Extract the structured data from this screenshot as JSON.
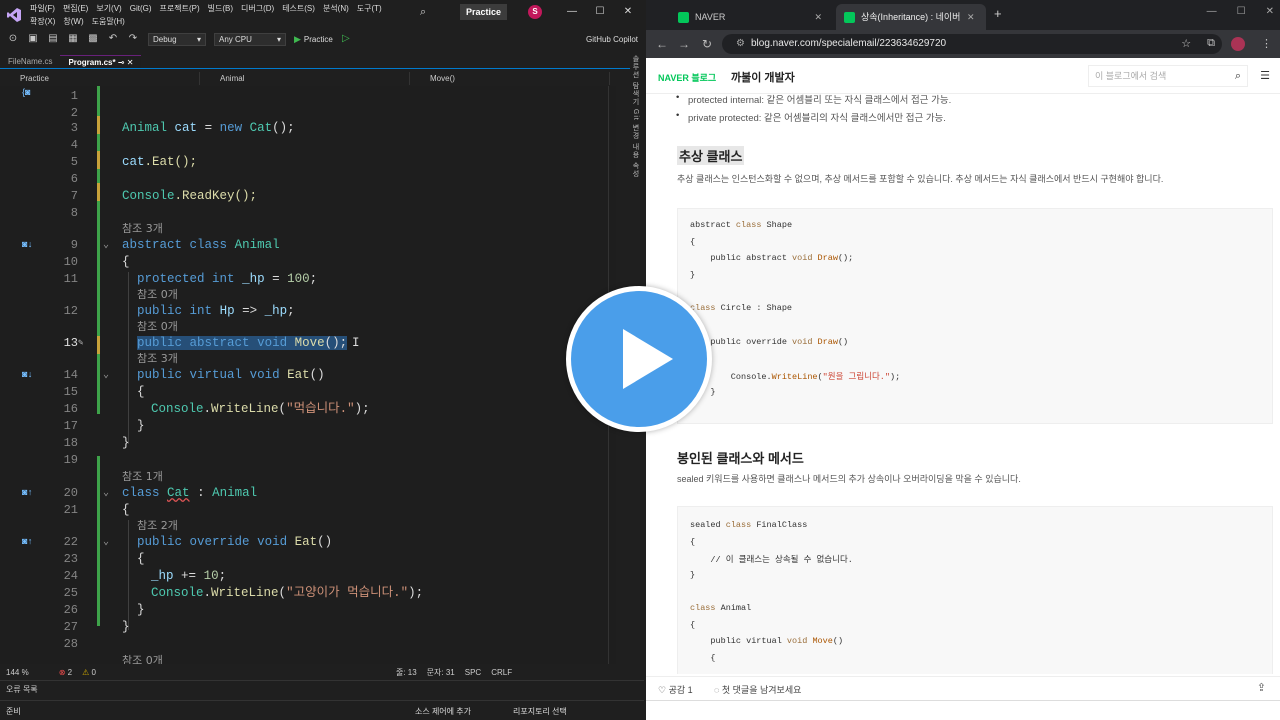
{
  "vs": {
    "menus": [
      "파일(F)",
      "편집(E)",
      "보기(V)",
      "Git(G)",
      "프로젝트(P)",
      "빌드(B)",
      "디버그(D)",
      "테스트(S)",
      "분석(N)",
      "도구(T)",
      "확장(X)",
      "창(W)",
      "도움말(H)"
    ],
    "title": "Practice",
    "avatar": "S",
    "toolbar": {
      "config": "Debug",
      "platform": "Any CPU",
      "run_label": "Practice",
      "copilot": "GitHub Copilot"
    },
    "tabs": [
      "FileName.cs",
      "Program.cs*"
    ],
    "navbar": {
      "project": "Practice",
      "class": "Animal",
      "member": "Move()"
    },
    "side_panel": "솔루션 탐색기 Git 변경 내용 속성",
    "code": {
      "l3": {
        "type": "Animal",
        "var": "cat",
        "eq": "=",
        "new": "new",
        "ctor": "Cat",
        "end": "();"
      },
      "l5": {
        "obj": "cat",
        "call": ".Eat();"
      },
      "l7": {
        "cls": "Console",
        "call": ".ReadKey();"
      },
      "refs_3": "참조 3개",
      "refs_0": "참조 0개",
      "refs_1": "참조 1개",
      "refs_2": "참조 2개",
      "kw_abstract": "abstract",
      "kw_class": "class",
      "kw_protected": "protected",
      "kw_int": "int",
      "kw_public": "public",
      "kw_void": "void",
      "kw_virtual": "virtual",
      "kw_override": "override",
      "name_animal": "Animal",
      "name_cat": "Cat",
      "field_hp": "_hp",
      "num_100": "100",
      "num_10": "10",
      "prop_hp": "Hp",
      "arrow": "=>",
      "move": "Move",
      "eat": "Eat",
      "console": "Console",
      "writeline": "WriteLine",
      "str_eat": "\"먹습니다.\"",
      "str_cat_eat": "\"고양이가 먹습니다.\"",
      "colon": ":",
      "plus_eq": "+="
    },
    "status": {
      "zoom": "144 %",
      "errors": "2",
      "warnings": "0",
      "line": "줄: 13",
      "col": "문자: 31",
      "spc": "SPC",
      "crlf": "CRLF"
    },
    "error_list": "오류 목록",
    "ready": "준비",
    "scm": "소스 제어에 추가",
    "repo": "리포지토리 선택"
  },
  "browser": {
    "tabs": [
      {
        "label": "NAVER"
      },
      {
        "label": "상속(Inheritance) : 네이버 블로"
      }
    ],
    "url": "blog.naver.com/specialemail/223634629720",
    "blog": {
      "naver": "NAVER",
      "blog_word": "블로그",
      "name": "까불이 개발자",
      "search_placeholder": "이 블로그에서 검색"
    },
    "content": {
      "bullet1": "protected internal: 같은 어셈블리 또는 자식 클래스에서 접근 가능.",
      "bullet2": "private protected: 같은 어셈블리의 자식 클래스에서만 접근 가능.",
      "h_abstract": "추상 클래스",
      "p_abstract": "추상 클래스는 인스턴스화할 수 없으며, 추상 메서드를 포함할 수 있습니다. 추상 메서드는 자식 클래스에서 반드시 구현해야 합니다.",
      "code1": [
        "abstract class Shape",
        "{",
        "    public abstract void Draw();",
        "}",
        "",
        "class Circle : Shape",
        "",
        "    public override void Draw()",
        "",
        "        Console.WriteLine(\"원을 그립니다.\");",
        "    }"
      ],
      "h_sealed": "봉인된 클래스와 메서드",
      "p_sealed": "sealed 키워드를 사용하면 클래스나 메서드의 추가 상속이나 오버라이딩을 막을 수 있습니다.",
      "code2": [
        "sealed class FinalClass",
        "{",
        "    // 이 클래스는 상속될 수 없습니다.",
        "}",
        "",
        "class Animal",
        "{",
        "    public virtual void Move()",
        "    {"
      ]
    },
    "bottom": {
      "like": "공감 1",
      "comment": "첫 댓글을 남겨보세요"
    }
  }
}
